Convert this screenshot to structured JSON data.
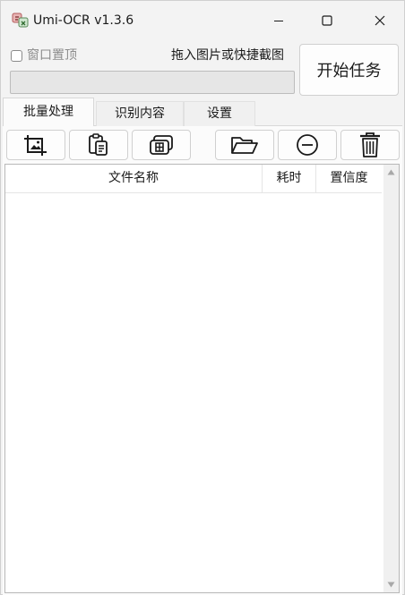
{
  "window": {
    "title": "Umi-OCR v1.3.6",
    "controls": {
      "minimize_icon": "minimize-icon",
      "maximize_icon": "maximize-icon",
      "close_icon": "close-icon"
    }
  },
  "top": {
    "window_topmost_label": "窗口置顶",
    "window_topmost_checked": false,
    "drop_hint": "拖入图片或快捷截图",
    "progress_fraction": 0,
    "start_button_label": "开始任务"
  },
  "tabs": [
    {
      "label": "批量处理",
      "active": true
    },
    {
      "label": "识别内容",
      "active": false
    },
    {
      "label": "设置",
      "active": false
    }
  ],
  "toolbar": [
    {
      "icon": "screenshot-image-icon"
    },
    {
      "icon": "paste-clipboard-icon"
    },
    {
      "icon": "window-capture-icon"
    },
    {
      "icon": "open-folder-icon"
    },
    {
      "icon": "remove-item-icon"
    },
    {
      "icon": "trash-icon"
    }
  ],
  "table": {
    "columns": [
      "文件名称",
      "耗时",
      "置信度"
    ],
    "rows": []
  },
  "colors": {
    "window_bg": "#f3f3f3",
    "panel_bg": "#fbfbfb",
    "border": "#d0d0d0",
    "progress_fill": "#06b025"
  }
}
